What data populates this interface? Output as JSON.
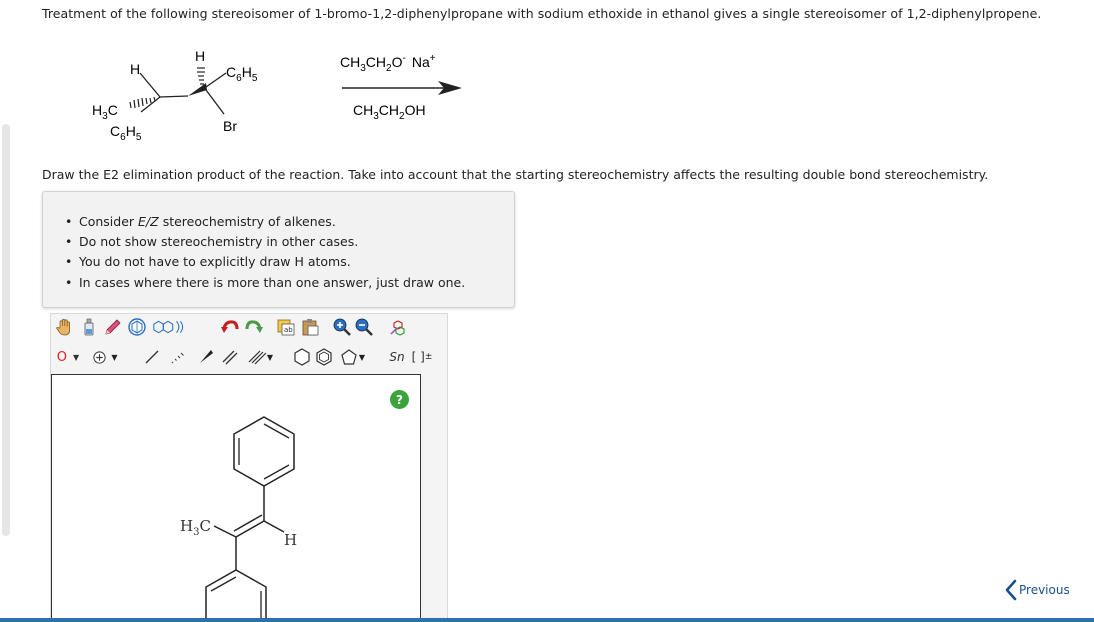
{
  "question": {
    "text": "Treatment of the following stereoisomer of 1-bromo-1,2-diphenylpropane with sodium ethoxide in ethanol gives a single stereoisomer of 1,2-diphenylpropene."
  },
  "reaction": {
    "substrate_labels": {
      "h_left": "H",
      "h_top": "H",
      "ph_right_main": "C",
      "ph_right_sub6": "6",
      "ph_right_h": "H",
      "ph_right_sub5": "5",
      "methyl_main": "H",
      "methyl_sub3": "3",
      "methyl_c": "C",
      "ph_bottom_main": "C",
      "ph_bottom_sub6": "6",
      "ph_bottom_h": "H",
      "ph_bottom_sub5": "5",
      "br": "Br"
    },
    "reagent_top": {
      "p1": "CH",
      "s1": "3",
      "p2": "CH",
      "s2": "2",
      "p3": "O",
      "sup_minus": "-",
      "p4": "Na",
      "sup_plus": "+"
    },
    "reagent_bottom": {
      "p1": "CH",
      "s1": "3",
      "p2": "CH",
      "s2": "2",
      "p3": "OH"
    }
  },
  "instruction": {
    "text": "Draw the E2 elimination product of the reaction. Take into account that the starting stereochemistry affects the resulting double bond stereochemistry."
  },
  "notes": {
    "item1_pre": "Consider ",
    "item1_em": "E/Z",
    "item1_post": " stereochemistry of alkenes.",
    "item2": "Do not show stereochemistry in other cases.",
    "item3": "You do not have to explicitly draw H atoms.",
    "item4": "In cases where there is more than one answer, just draw one."
  },
  "toolbar": {
    "row1_icons": [
      "hand-icon",
      "eraser-bottle-icon",
      "pencil-icon",
      "ring-template-icon",
      "chain-template-icon",
      "undo-icon",
      "redo-icon",
      "copy-icon",
      "paste-icon",
      "zoom-in-icon",
      "zoom-out-icon",
      "clean-structure-icon"
    ],
    "row2_icons": [
      "atom-o-icon",
      "charge-plus-icon",
      "single-bond-icon",
      "hash-bond-icon",
      "wedge-bond-icon",
      "double-bond-icon",
      "triple-bond-icon",
      "cyclohexane-icon",
      "benzene-icon",
      "cyclopentane-icon",
      "sn-polymer-icon",
      "bracket-charge-icon"
    ],
    "atom_label": "O",
    "sn_label": "Sn",
    "bracket_label": "[ ]",
    "bracket_sup": "±"
  },
  "canvas": {
    "methyl_label_main": "H",
    "methyl_label_sub": "3",
    "methyl_label_c": "C",
    "h_label": "H",
    "help_label": "?"
  },
  "navigation": {
    "previous_label": "Previous"
  },
  "colors": {
    "accent_blue": "#2f6fae",
    "help_green": "#3aa33a",
    "atom_red": "#d22",
    "link_blue": "#1a4f8f"
  }
}
